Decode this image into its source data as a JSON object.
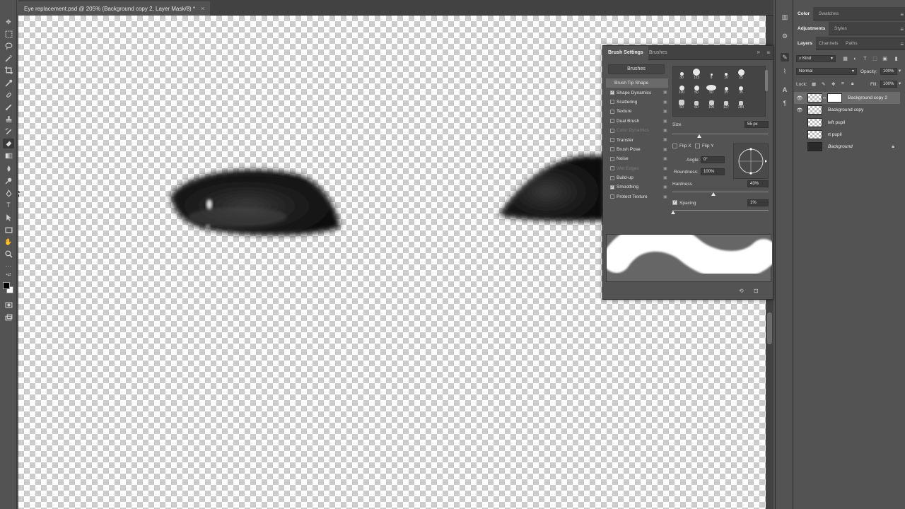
{
  "document": {
    "tab_title": "Eye replacement.psd @ 205% (Background copy 2, Layer Mask/8) *",
    "close_glyph": "×"
  },
  "brush_settings": {
    "tabs": [
      "Brush Settings",
      "Brushes"
    ],
    "brushes_button": "Brushes",
    "options": [
      {
        "label": "Brush Tip Shape",
        "checkbox": false,
        "checked": false,
        "selected": true,
        "enabled": true,
        "lock": false
      },
      {
        "label": "Shape Dynamics",
        "checkbox": true,
        "checked": true,
        "selected": false,
        "enabled": true,
        "lock": true
      },
      {
        "label": "Scattering",
        "checkbox": true,
        "checked": false,
        "selected": false,
        "enabled": true,
        "lock": true
      },
      {
        "label": "Texture",
        "checkbox": true,
        "checked": false,
        "selected": false,
        "enabled": true,
        "lock": true
      },
      {
        "label": "Dual Brush",
        "checkbox": true,
        "checked": false,
        "selected": false,
        "enabled": true,
        "lock": true
      },
      {
        "label": "Color Dynamics",
        "checkbox": true,
        "checked": false,
        "selected": false,
        "enabled": false,
        "lock": true
      },
      {
        "label": "Transfer",
        "checkbox": true,
        "checked": false,
        "selected": false,
        "enabled": true,
        "lock": true
      },
      {
        "label": "Brush Pose",
        "checkbox": true,
        "checked": false,
        "selected": false,
        "enabled": true,
        "lock": true
      },
      {
        "label": "Noise",
        "checkbox": true,
        "checked": false,
        "selected": false,
        "enabled": true,
        "lock": true
      },
      {
        "label": "Wet Edges",
        "checkbox": true,
        "checked": false,
        "selected": false,
        "enabled": false,
        "lock": true
      },
      {
        "label": "Build-up",
        "checkbox": true,
        "checked": false,
        "selected": false,
        "enabled": true,
        "lock": true
      },
      {
        "label": "Smoothing",
        "checkbox": true,
        "checked": true,
        "selected": false,
        "enabled": true,
        "lock": true
      },
      {
        "label": "Protect Texture",
        "checkbox": true,
        "checked": false,
        "selected": false,
        "enabled": true,
        "lock": true
      }
    ],
    "presets": [
      [
        "30",
        "123",
        "8",
        "10",
        "25"
      ],
      [
        "100",
        "50",
        "50",
        "35",
        "35"
      ],
      [
        "50",
        "60",
        "100",
        "127",
        "284"
      ]
    ],
    "size_label": "Size",
    "size_value": "55 px",
    "flip_x_label": "Flip X",
    "flip_y_label": "Flip Y",
    "angle_label": "Angle:",
    "angle_value": "0°",
    "roundness_label": "Roundness:",
    "roundness_value": "100%",
    "hardness_label": "Hardness",
    "hardness_value": "43%",
    "spacing_label": "Spacing",
    "spacing_value": "1%",
    "spacing_checked": true,
    "size_level": 0.28,
    "hardness_level": 0.43,
    "spacing_level": 0.01
  },
  "right_panels": {
    "color_tabs": [
      "Color",
      "Swatches"
    ],
    "adjust_tabs": [
      "Adjustments",
      "Styles"
    ],
    "layers_tabs": [
      "Layers",
      "Channels",
      "Paths"
    ],
    "filter_kind": "Kind",
    "blend_mode": "Normal",
    "opacity_label": "Opacity:",
    "opacity_value": "100%",
    "lock_label": "Lock:",
    "fill_label": "Fill:",
    "fill_value": "100%",
    "layers": [
      {
        "name": "Background copy 2",
        "visible": true,
        "selected": true,
        "mask": true,
        "italic": false,
        "locked": false
      },
      {
        "name": "Background copy",
        "visible": true,
        "selected": false,
        "mask": false,
        "italic": false,
        "locked": false
      },
      {
        "name": "left pupil",
        "visible": false,
        "selected": false,
        "mask": false,
        "italic": false,
        "locked": false
      },
      {
        "name": "rt pupil",
        "visible": false,
        "selected": false,
        "mask": false,
        "italic": false,
        "locked": false
      },
      {
        "name": "Background",
        "visible": false,
        "selected": false,
        "mask": false,
        "italic": true,
        "locked": true
      }
    ]
  }
}
